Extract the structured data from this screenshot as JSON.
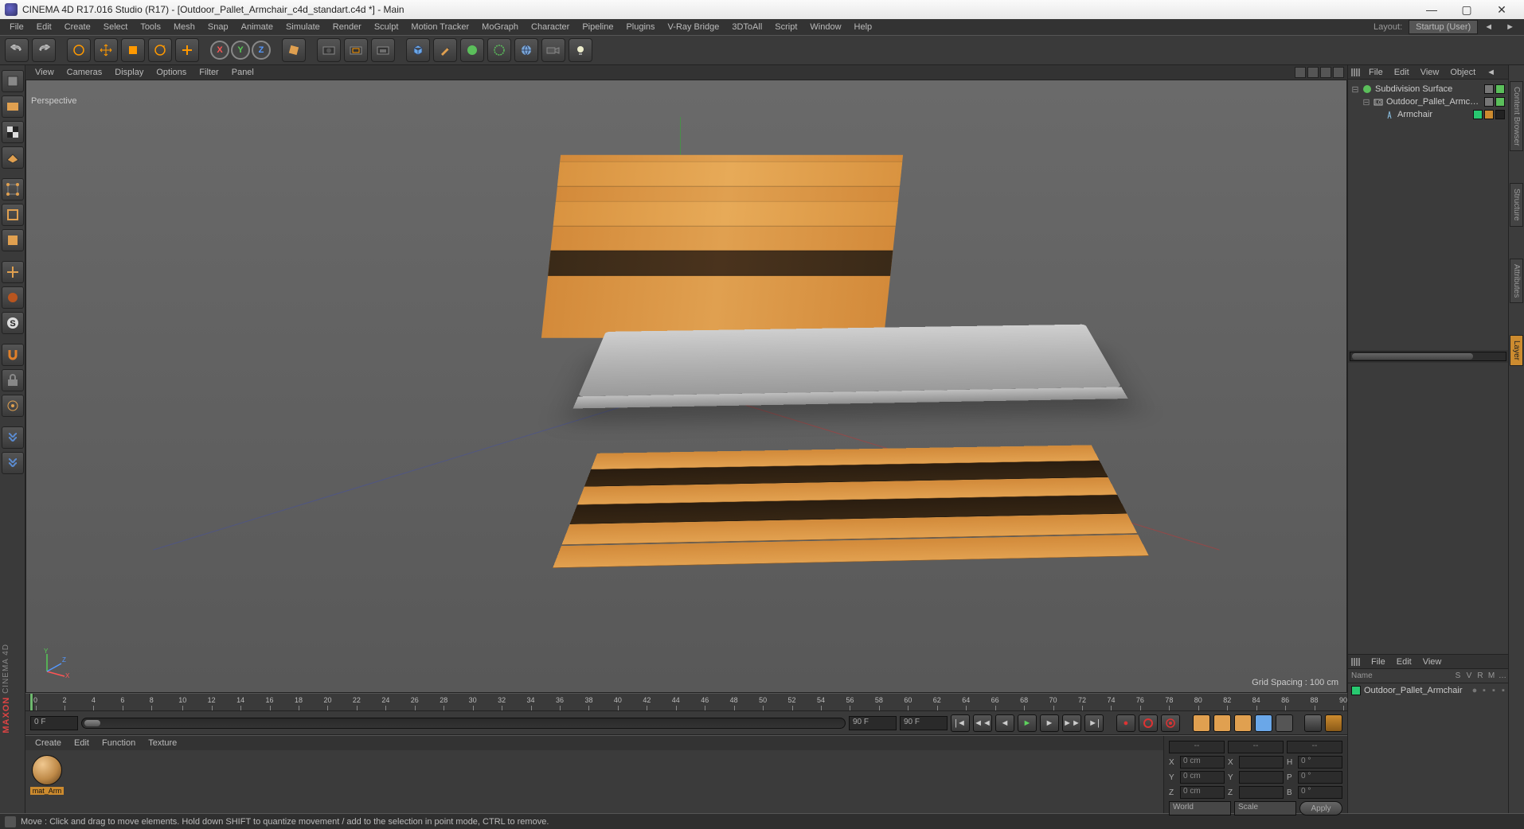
{
  "titlebar": {
    "text": "CINEMA 4D R17.016 Studio (R17) - [Outdoor_Pallet_Armchair_c4d_standart.c4d *] - Main"
  },
  "menubar": {
    "items": [
      "File",
      "Edit",
      "Create",
      "Select",
      "Tools",
      "Mesh",
      "Snap",
      "Animate",
      "Simulate",
      "Render",
      "Sculpt",
      "Motion Tracker",
      "MoGraph",
      "Character",
      "Pipeline",
      "Plugins",
      "V-Ray Bridge",
      "3DToAll",
      "Script",
      "Window",
      "Help"
    ],
    "layout_label": "Layout:",
    "layout_value": "Startup (User)"
  },
  "viewport_menu": {
    "items": [
      "View",
      "Cameras",
      "Display",
      "Options",
      "Filter",
      "Panel"
    ]
  },
  "viewport": {
    "label": "Perspective",
    "grid_text": "Grid Spacing : 100 cm"
  },
  "timeline": {
    "start": "0 F",
    "startB": "0 F",
    "end": "90 F",
    "endB": "90 F",
    "ticks": [
      0,
      2,
      4,
      6,
      8,
      10,
      12,
      14,
      16,
      18,
      20,
      22,
      24,
      26,
      28,
      30,
      32,
      34,
      36,
      38,
      40,
      42,
      44,
      46,
      48,
      50,
      52,
      54,
      56,
      58,
      60,
      62,
      64,
      66,
      68,
      70,
      72,
      74,
      76,
      78,
      80,
      82,
      84,
      86,
      88,
      90
    ]
  },
  "material_menu": {
    "items": [
      "Create",
      "Edit",
      "Function",
      "Texture"
    ]
  },
  "material": {
    "name": "mat_Arm"
  },
  "coords": {
    "hdr": [
      "--",
      "--",
      "--"
    ],
    "x": "0 cm",
    "y": "0 cm",
    "z": "0 cm",
    "sx": "X",
    "sy": "Y",
    "sz": "Z",
    "hx": "0 °",
    "hy": "0 °",
    "hz": "0 °",
    "h": "H",
    "p": "P",
    "b": "B",
    "world": "World",
    "scale": "Scale",
    "apply": "Apply"
  },
  "obj_panel_menu": {
    "items": [
      "File",
      "Edit",
      "View",
      "Object"
    ]
  },
  "objects": [
    {
      "indent": 0,
      "icon": "subdiv",
      "label": "Subdivision Surface",
      "tags": [
        "gray",
        "green-check"
      ]
    },
    {
      "indent": 1,
      "icon": "null",
      "label": "Outdoor_Pallet_Armchair",
      "tags": [
        "gray",
        "green-check"
      ]
    },
    {
      "indent": 2,
      "icon": "poly",
      "label": "Armchair",
      "tags": [
        "green",
        "tex",
        "sel"
      ]
    }
  ],
  "layer_panel_menu": {
    "items": [
      "File",
      "Edit",
      "View"
    ]
  },
  "layer_cols": {
    "name": "Name",
    "s": "S",
    "v": "V",
    "r": "R",
    "m": "M",
    "l": "…"
  },
  "layer_row": {
    "name": "Outdoor_Pallet_Armchair"
  },
  "right_tabs": [
    "Content Browser",
    "Structure",
    "Attributes",
    "Layer"
  ],
  "status": {
    "text": "Move : Click and drag to move elements. Hold down SHIFT to quantize movement / add to the selection in point mode, CTRL to remove."
  }
}
